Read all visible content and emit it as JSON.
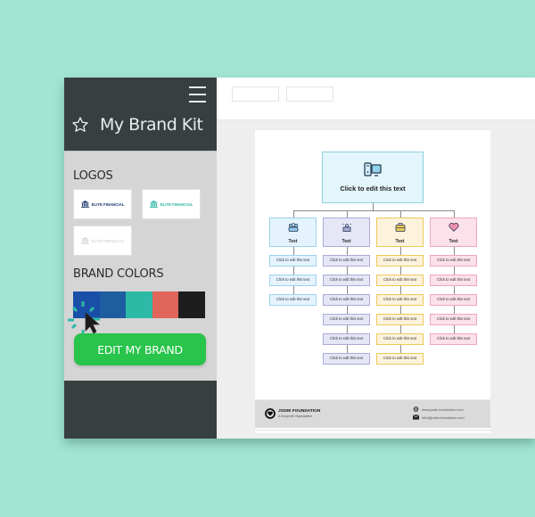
{
  "sidebar": {
    "title": "My Brand Kit",
    "icons": {
      "menu": "hamburger-menu-icon",
      "title": "star-icon"
    },
    "logos_label": "LOGOS",
    "logos": [
      {
        "text": "ELITE FINANCIAL",
        "variant": "navy",
        "color": "#1e3a6e"
      },
      {
        "text": "ELITE FINANCIAL",
        "variant": "teal",
        "color": "#2bb5a3"
      },
      {
        "text": "ELITE FINANCIAL",
        "variant": "light",
        "color": "#d8d8d8"
      }
    ],
    "colors_label": "BRAND COLORS",
    "brand_colors": [
      "#1a4fa8",
      "#1e5ea0",
      "#2cbaa7",
      "#e0655b",
      "#1d1d1d"
    ],
    "edit_button": "EDIT MY BRAND"
  },
  "toolbar": {
    "buttons": [
      "",
      ""
    ]
  },
  "document": {
    "top_box": {
      "icon": "computer-icon",
      "text": "Click to edit this text",
      "bg": "#e3f6fb",
      "border": "#8ccfdc"
    },
    "columns": [
      {
        "heading": "Text",
        "icon": "team-icon",
        "bg": "#e4f3fd",
        "border": "#9fd2ee",
        "items": [
          "Click to edit this text",
          "Click to edit this text",
          "Click to edit this text"
        ]
      },
      {
        "heading": "Text",
        "icon": "presenter-icon",
        "bg": "#e6e6f7",
        "border": "#a9acd8",
        "items": [
          "Click to edit this text",
          "Click to edit this text",
          "Click to edit this text",
          "Click to edit this text",
          "Click to edit this text",
          "Click to edit this text"
        ]
      },
      {
        "heading": "Text",
        "icon": "briefcase-icon",
        "bg": "#fdf3dc",
        "border": "#ecc95a",
        "items": [
          "Click to edit this text",
          "Click to edit this text",
          "Click to edit this text",
          "Click to edit this text",
          "Click to edit this text",
          "Click to edit this text"
        ]
      },
      {
        "heading": "Text",
        "icon": "heart-icon",
        "bg": "#fce1ea",
        "border": "#f0a7bd",
        "items": [
          "Click to edit this text",
          "Click to edit this text",
          "Click to edit this text",
          "Click to edit this text",
          "Click to edit this text"
        ]
      }
    ],
    "footer": {
      "org_name": "JODIE FOUNDATION",
      "org_tagline": "A Nonprofit Organization",
      "website": "www.jodie-foundation.com",
      "email": "info@jodie-foundation.com"
    }
  }
}
